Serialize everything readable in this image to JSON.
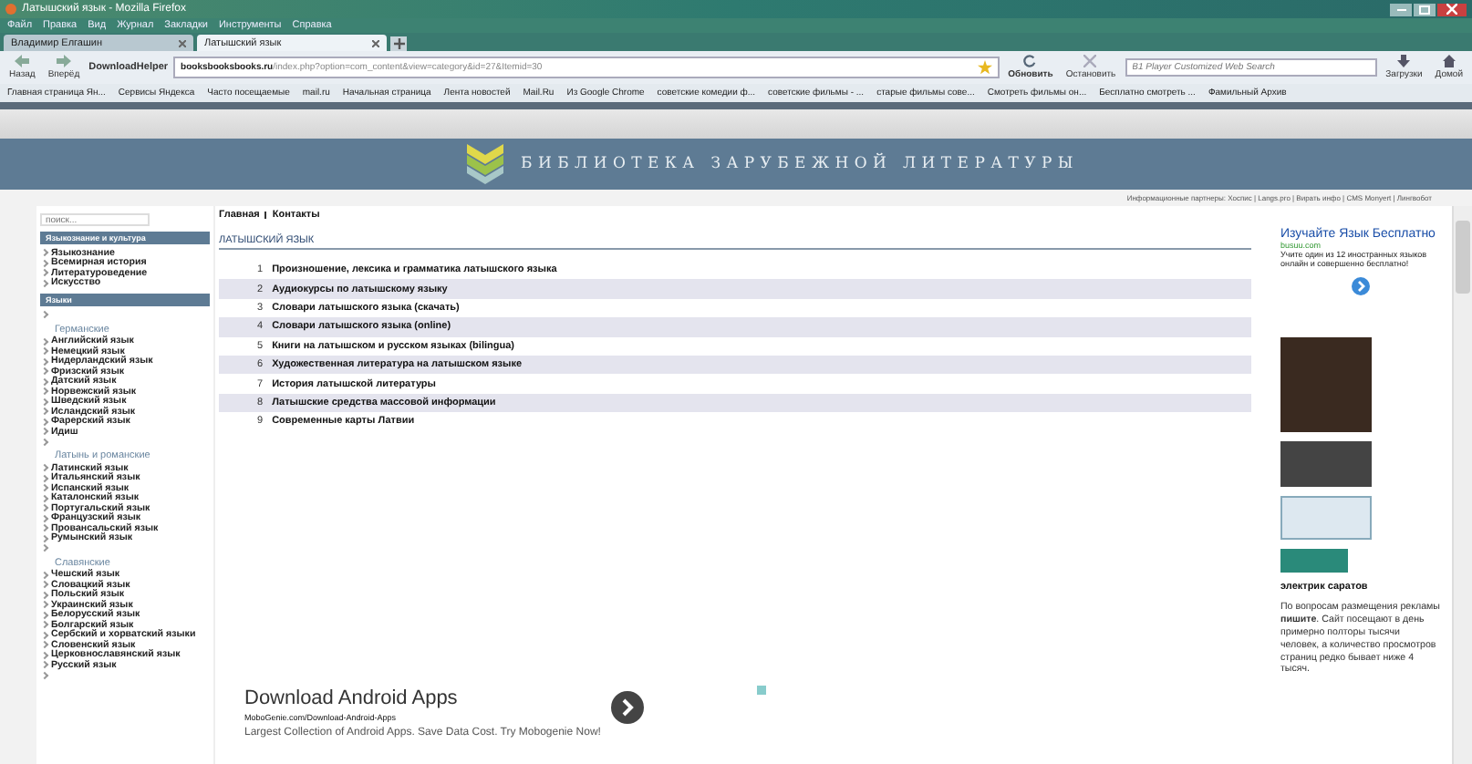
{
  "window": {
    "title": "Латышский язык - Mozilla Firefox"
  },
  "menu": [
    "Файл",
    "Правка",
    "Вид",
    "Журнал",
    "Закладки",
    "Инструменты",
    "Справка"
  ],
  "tabs": [
    {
      "label": "Владимир Елгашин",
      "selected": false
    },
    {
      "label": "Латышский язык",
      "selected": true
    }
  ],
  "toolbar": {
    "back": "Назад",
    "forward": "Вперёд",
    "helper": "DownloadHelper",
    "url_host": "booksbooksbooks.ru",
    "url_path": "/index.php?option=com_content&view=category&id=27&Itemid=30",
    "reload": "Обновить",
    "stop": "Остановить",
    "search_placeholder": "B1 Player Customized Web Search",
    "downloads": "Загрузки",
    "home": "Домой"
  },
  "bookmarks": [
    "Главная страница Ян...",
    "Сервисы Яндекса",
    "Часто посещаемые",
    "mail.ru",
    "Начальная страница",
    "Лента новостей",
    "Mail.Ru",
    "Из Google Chrome",
    "советские комедии ф...",
    "советские фильмы - ...",
    "старые фильмы сове...",
    "Смотреть фильмы он...",
    "Бесплатно смотреть ...",
    "Фамильный Архив"
  ],
  "site": {
    "title": "БИБЛИОТЕКА ЗАРУБЕЖНОЙ ЛИТЕРАТУРЫ",
    "partners": "Информационные партнеры: Хоспис | Langs.pro | Вирать инфо | CMS Monyert | Лингвобот"
  },
  "sidebar": {
    "search_placeholder": "поиск...",
    "sections": [
      {
        "title": "Языкознание и культура",
        "items": [
          {
            "kind": "link",
            "label": "Языкознание"
          },
          {
            "kind": "link",
            "label": "Всемирная история"
          },
          {
            "kind": "link",
            "label": "Литературоведение"
          },
          {
            "kind": "link",
            "label": "Искусство"
          }
        ]
      },
      {
        "title": "Языки",
        "items": [
          {
            "kind": "blank"
          },
          {
            "kind": "group",
            "label": "Германские"
          },
          {
            "kind": "link",
            "label": "Английский язык"
          },
          {
            "kind": "link",
            "label": "Немецкий язык"
          },
          {
            "kind": "link",
            "label": "Нидерландский язык"
          },
          {
            "kind": "link",
            "label": "Фризский язык"
          },
          {
            "kind": "link",
            "label": "Датский язык"
          },
          {
            "kind": "link",
            "label": "Норвежский язык"
          },
          {
            "kind": "link",
            "label": "Шведский язык"
          },
          {
            "kind": "link",
            "label": "Исландский язык"
          },
          {
            "kind": "link",
            "label": "Фарерский язык"
          },
          {
            "kind": "link",
            "label": "Идиш"
          },
          {
            "kind": "blank"
          },
          {
            "kind": "group",
            "label": "Латынь и романские"
          },
          {
            "kind": "link",
            "label": "Латинский язык"
          },
          {
            "kind": "link",
            "label": "Итальянский язык"
          },
          {
            "kind": "link",
            "label": "Испанский язык"
          },
          {
            "kind": "link",
            "label": "Каталонский язык"
          },
          {
            "kind": "link",
            "label": "Португальский язык"
          },
          {
            "kind": "link",
            "label": "Французский язык"
          },
          {
            "kind": "link",
            "label": "Провансальский язык"
          },
          {
            "kind": "link",
            "label": "Румынский язык"
          },
          {
            "kind": "blank"
          },
          {
            "kind": "group",
            "label": "Славянские"
          },
          {
            "kind": "link",
            "label": "Чешский язык"
          },
          {
            "kind": "link",
            "label": "Словацкий язык"
          },
          {
            "kind": "link",
            "label": "Польский язык"
          },
          {
            "kind": "link",
            "label": "Украинский язык"
          },
          {
            "kind": "link",
            "label": "Белорусский язык"
          },
          {
            "kind": "link",
            "label": "Болгарский язык"
          },
          {
            "kind": "link",
            "label": "Сербский и хорватский языки"
          },
          {
            "kind": "link",
            "label": "Словенский язык"
          },
          {
            "kind": "link",
            "label": "Церковнославянский язык"
          },
          {
            "kind": "link",
            "label": "Русский язык"
          },
          {
            "kind": "blank"
          }
        ]
      }
    ]
  },
  "breadcrumbs": [
    "Главная",
    "Контакты"
  ],
  "heading": "ЛАТЫШСКИЙ ЯЗЫК",
  "articles": [
    {
      "number": "1",
      "title": "Произношение, лексика и грамматика латышского языка"
    },
    {
      "number": "2",
      "title": "Аудиокурсы по латышскому языку"
    },
    {
      "number": "3",
      "title": "Словари латышского языка (скачать)"
    },
    {
      "number": "4",
      "title": "Словари латышского языка (online)"
    },
    {
      "number": "5",
      "title": "Книги на латышском и русском языках (bilingua)"
    },
    {
      "number": "6",
      "title": "Художественная литература на латышском языке"
    },
    {
      "number": "7",
      "title": "История латышской литературы"
    },
    {
      "number": "8",
      "title": "Латышские средства массовой информации"
    },
    {
      "number": "9",
      "title": "Современные карты Латвии"
    }
  ],
  "bottom_ad": {
    "title": "Download Android Apps",
    "url": "MoboGenie.com/Download-Android-Apps",
    "text": "Largest Collection of Android Apps. Save Data Cost. Try Mobogenie Now!"
  },
  "right_ad": {
    "title": "Изучайте Язык Бесплатно",
    "domain": "busuu.com",
    "text": "Учите один из 12 иностранных языков онлайн и совершенно бесплатно!"
  },
  "right_heading": "электрик саратов",
  "right_note": "По вопросам размещения рекламы **пишите**. Сайт посещают в день примерно полторы тысячи человек, а количество просмотров страниц редко бывает ниже 4 тысяч."
}
